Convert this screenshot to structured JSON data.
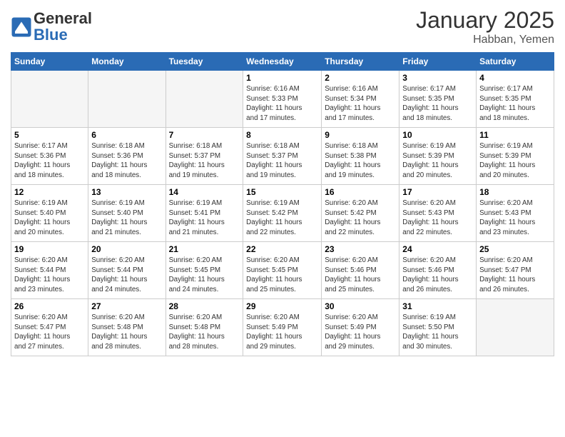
{
  "header": {
    "logo_general": "General",
    "logo_blue": "Blue",
    "month_title": "January 2025",
    "location": "Habban, Yemen"
  },
  "weekdays": [
    "Sunday",
    "Monday",
    "Tuesday",
    "Wednesday",
    "Thursday",
    "Friday",
    "Saturday"
  ],
  "weeks": [
    [
      {
        "day": "",
        "info": ""
      },
      {
        "day": "",
        "info": ""
      },
      {
        "day": "",
        "info": ""
      },
      {
        "day": "1",
        "info": "Sunrise: 6:16 AM\nSunset: 5:33 PM\nDaylight: 11 hours\nand 17 minutes."
      },
      {
        "day": "2",
        "info": "Sunrise: 6:16 AM\nSunset: 5:34 PM\nDaylight: 11 hours\nand 17 minutes."
      },
      {
        "day": "3",
        "info": "Sunrise: 6:17 AM\nSunset: 5:35 PM\nDaylight: 11 hours\nand 18 minutes."
      },
      {
        "day": "4",
        "info": "Sunrise: 6:17 AM\nSunset: 5:35 PM\nDaylight: 11 hours\nand 18 minutes."
      }
    ],
    [
      {
        "day": "5",
        "info": "Sunrise: 6:17 AM\nSunset: 5:36 PM\nDaylight: 11 hours\nand 18 minutes."
      },
      {
        "day": "6",
        "info": "Sunrise: 6:18 AM\nSunset: 5:36 PM\nDaylight: 11 hours\nand 18 minutes."
      },
      {
        "day": "7",
        "info": "Sunrise: 6:18 AM\nSunset: 5:37 PM\nDaylight: 11 hours\nand 19 minutes."
      },
      {
        "day": "8",
        "info": "Sunrise: 6:18 AM\nSunset: 5:37 PM\nDaylight: 11 hours\nand 19 minutes."
      },
      {
        "day": "9",
        "info": "Sunrise: 6:18 AM\nSunset: 5:38 PM\nDaylight: 11 hours\nand 19 minutes."
      },
      {
        "day": "10",
        "info": "Sunrise: 6:19 AM\nSunset: 5:39 PM\nDaylight: 11 hours\nand 20 minutes."
      },
      {
        "day": "11",
        "info": "Sunrise: 6:19 AM\nSunset: 5:39 PM\nDaylight: 11 hours\nand 20 minutes."
      }
    ],
    [
      {
        "day": "12",
        "info": "Sunrise: 6:19 AM\nSunset: 5:40 PM\nDaylight: 11 hours\nand 20 minutes."
      },
      {
        "day": "13",
        "info": "Sunrise: 6:19 AM\nSunset: 5:40 PM\nDaylight: 11 hours\nand 21 minutes."
      },
      {
        "day": "14",
        "info": "Sunrise: 6:19 AM\nSunset: 5:41 PM\nDaylight: 11 hours\nand 21 minutes."
      },
      {
        "day": "15",
        "info": "Sunrise: 6:19 AM\nSunset: 5:42 PM\nDaylight: 11 hours\nand 22 minutes."
      },
      {
        "day": "16",
        "info": "Sunrise: 6:20 AM\nSunset: 5:42 PM\nDaylight: 11 hours\nand 22 minutes."
      },
      {
        "day": "17",
        "info": "Sunrise: 6:20 AM\nSunset: 5:43 PM\nDaylight: 11 hours\nand 22 minutes."
      },
      {
        "day": "18",
        "info": "Sunrise: 6:20 AM\nSunset: 5:43 PM\nDaylight: 11 hours\nand 23 minutes."
      }
    ],
    [
      {
        "day": "19",
        "info": "Sunrise: 6:20 AM\nSunset: 5:44 PM\nDaylight: 11 hours\nand 23 minutes."
      },
      {
        "day": "20",
        "info": "Sunrise: 6:20 AM\nSunset: 5:44 PM\nDaylight: 11 hours\nand 24 minutes."
      },
      {
        "day": "21",
        "info": "Sunrise: 6:20 AM\nSunset: 5:45 PM\nDaylight: 11 hours\nand 24 minutes."
      },
      {
        "day": "22",
        "info": "Sunrise: 6:20 AM\nSunset: 5:45 PM\nDaylight: 11 hours\nand 25 minutes."
      },
      {
        "day": "23",
        "info": "Sunrise: 6:20 AM\nSunset: 5:46 PM\nDaylight: 11 hours\nand 25 minutes."
      },
      {
        "day": "24",
        "info": "Sunrise: 6:20 AM\nSunset: 5:46 PM\nDaylight: 11 hours\nand 26 minutes."
      },
      {
        "day": "25",
        "info": "Sunrise: 6:20 AM\nSunset: 5:47 PM\nDaylight: 11 hours\nand 26 minutes."
      }
    ],
    [
      {
        "day": "26",
        "info": "Sunrise: 6:20 AM\nSunset: 5:47 PM\nDaylight: 11 hours\nand 27 minutes."
      },
      {
        "day": "27",
        "info": "Sunrise: 6:20 AM\nSunset: 5:48 PM\nDaylight: 11 hours\nand 28 minutes."
      },
      {
        "day": "28",
        "info": "Sunrise: 6:20 AM\nSunset: 5:48 PM\nDaylight: 11 hours\nand 28 minutes."
      },
      {
        "day": "29",
        "info": "Sunrise: 6:20 AM\nSunset: 5:49 PM\nDaylight: 11 hours\nand 29 minutes."
      },
      {
        "day": "30",
        "info": "Sunrise: 6:20 AM\nSunset: 5:49 PM\nDaylight: 11 hours\nand 29 minutes."
      },
      {
        "day": "31",
        "info": "Sunrise: 6:19 AM\nSunset: 5:50 PM\nDaylight: 11 hours\nand 30 minutes."
      },
      {
        "day": "",
        "info": ""
      }
    ]
  ]
}
